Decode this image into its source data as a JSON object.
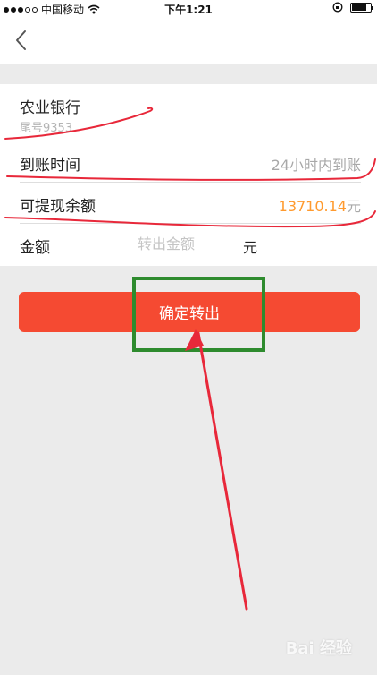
{
  "status_bar": {
    "carrier": "中国移动",
    "time": "下午1:21"
  },
  "nav": {
    "back_icon": "chevron-left-icon"
  },
  "account": {
    "bank_name": "农业银行",
    "tail_number": "尾号9353"
  },
  "arrival": {
    "label": "到账时间",
    "value": "24小时内到账"
  },
  "balance": {
    "label": "可提现余额",
    "amount": "13710.14",
    "unit": "元"
  },
  "amount_field": {
    "label": "金额",
    "placeholder": "转出金额",
    "unit": "元"
  },
  "confirm_button": {
    "label": "确定转出"
  },
  "colors": {
    "accent_button": "#f54a32",
    "balance_highlight": "#ff9a2e",
    "annotation_red": "#e8283a",
    "annotation_green": "#2e8b2e"
  },
  "watermark": {
    "text": "Bai 经验"
  }
}
